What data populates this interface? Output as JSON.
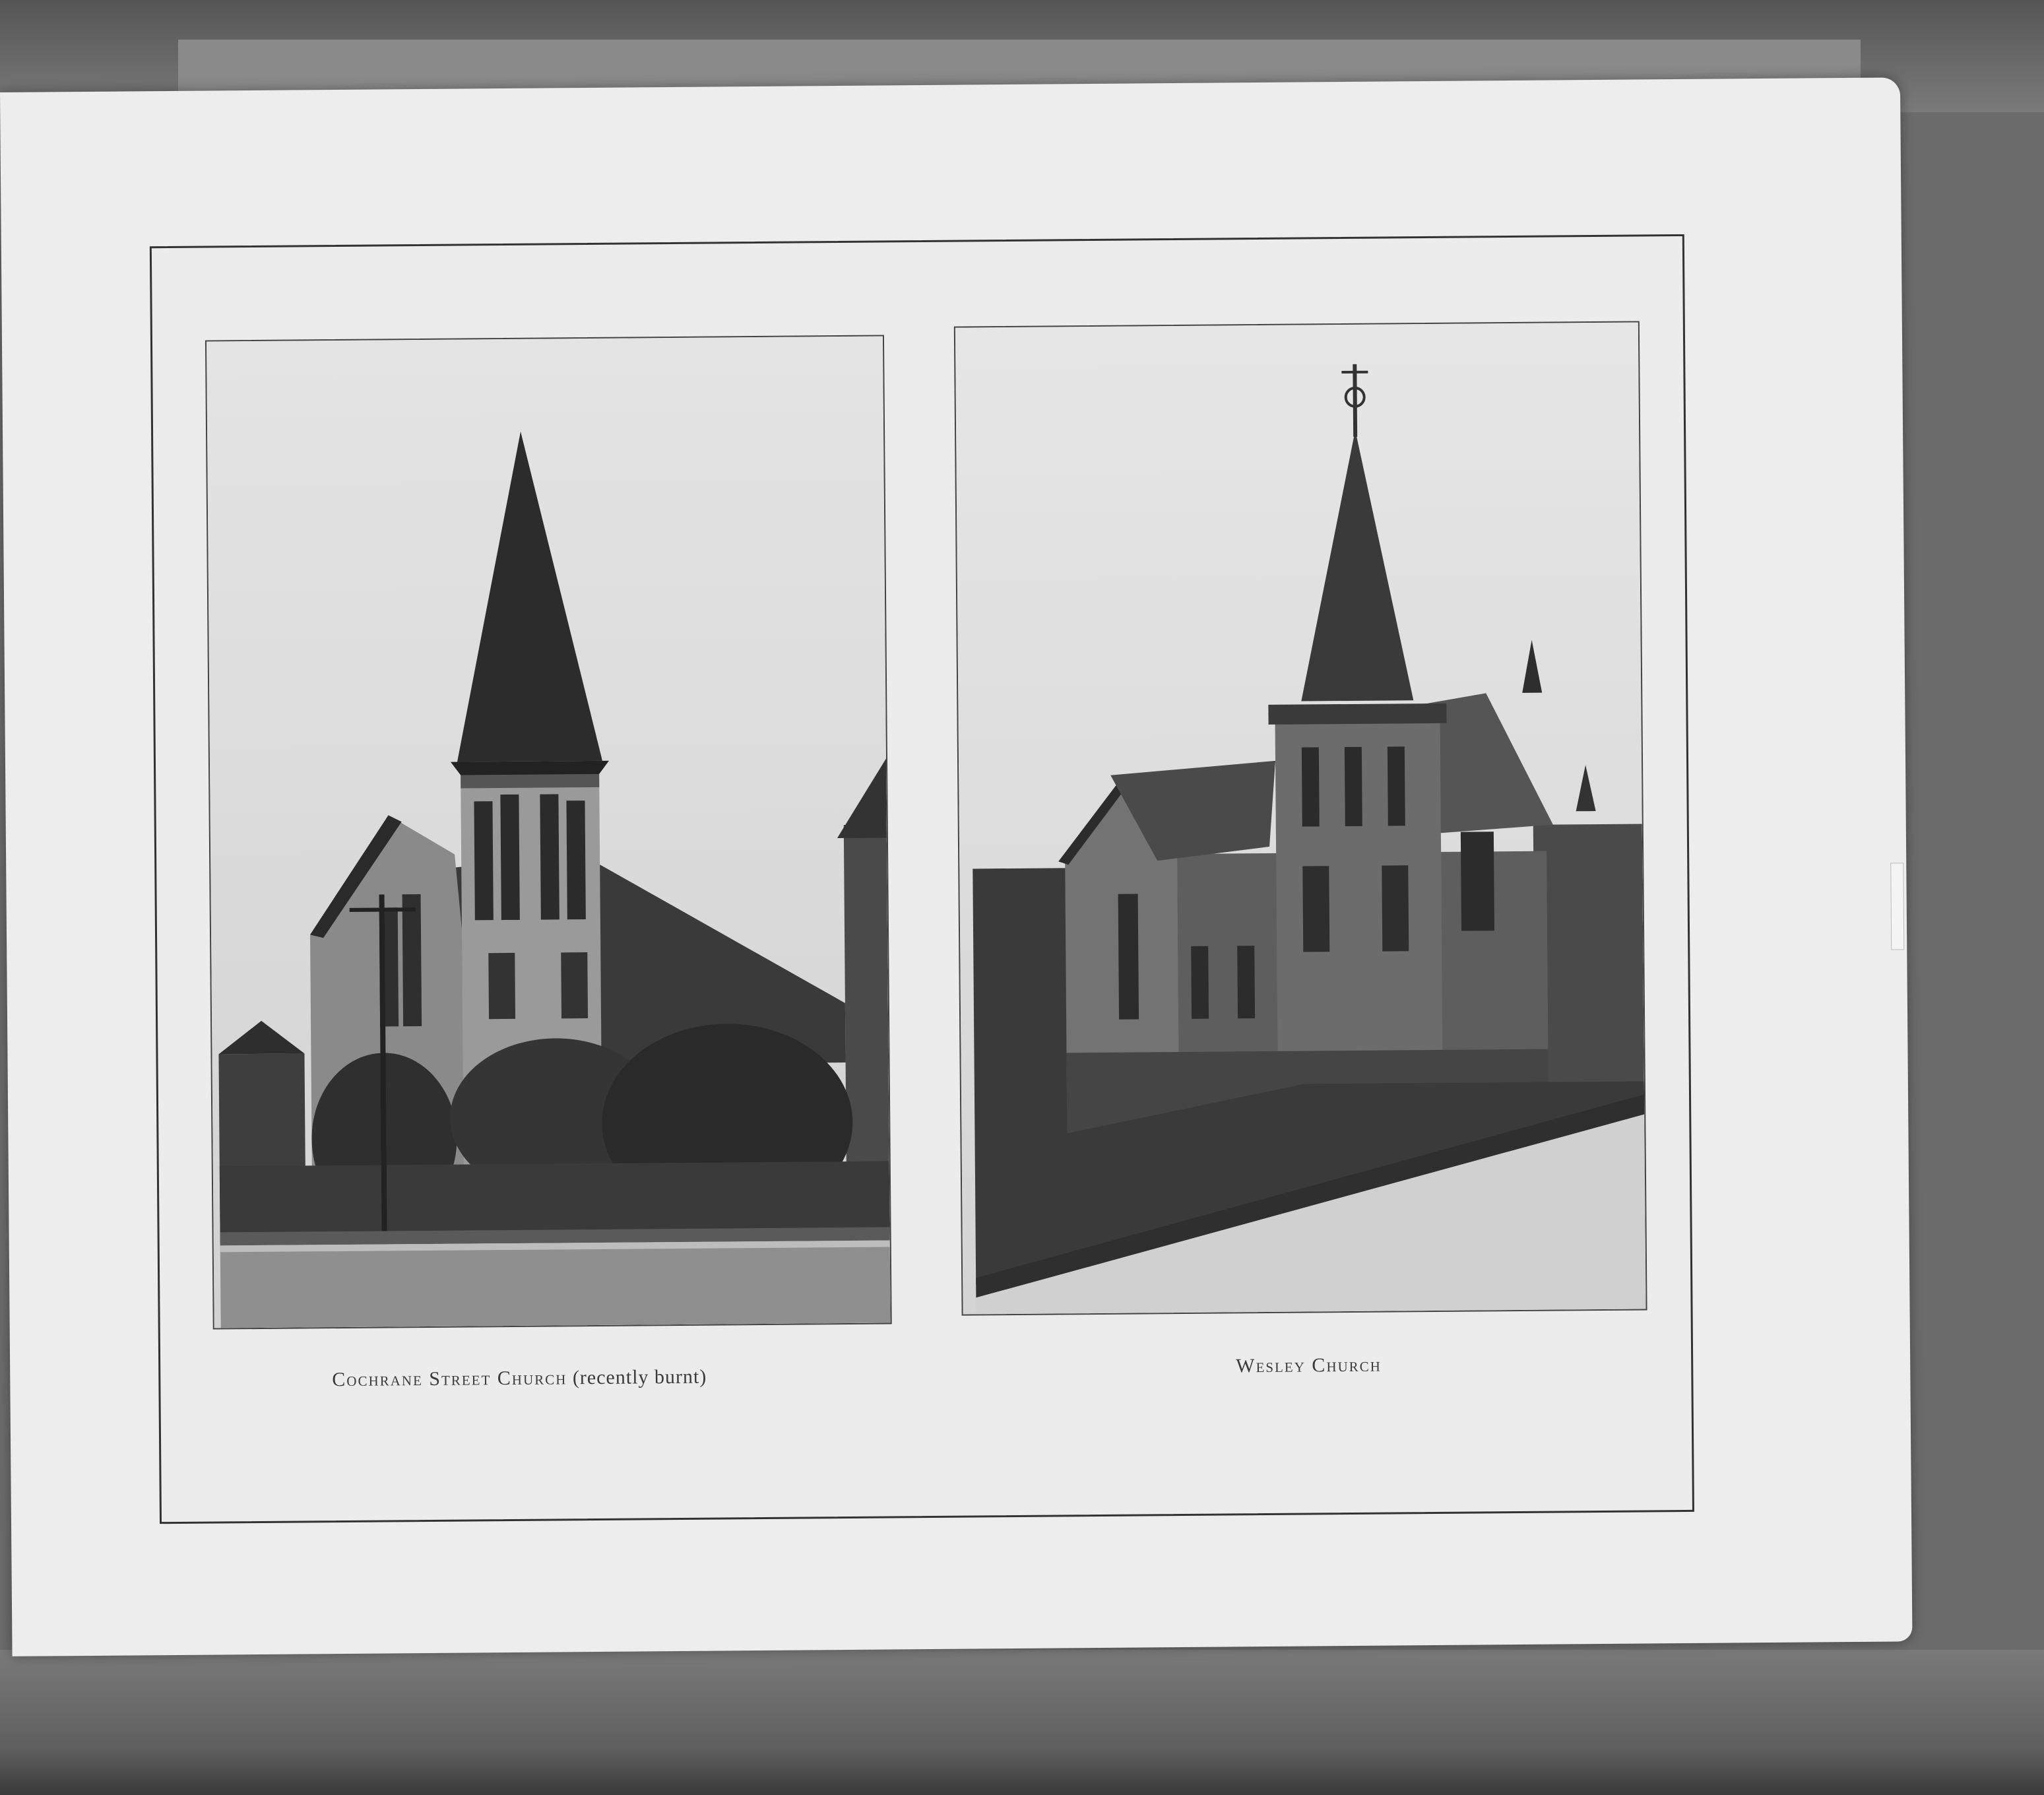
{
  "document": {
    "plates": [
      {
        "caption_name": "Cochrane Street Church",
        "caption_note": "(recently burnt)"
      },
      {
        "caption_name": "Wesley Church"
      }
    ]
  }
}
